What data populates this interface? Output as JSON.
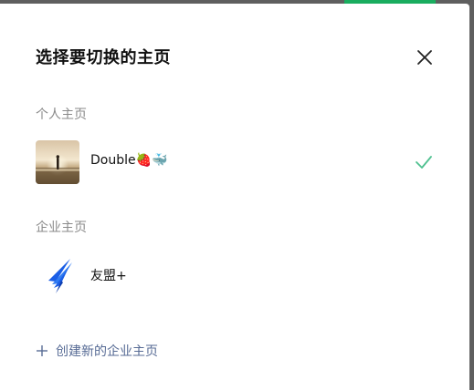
{
  "dialog": {
    "title": "选择要切换的主页",
    "close_icon": "close-icon"
  },
  "personal": {
    "section_label": "个人主页",
    "account": {
      "name": "Double🍓🐳",
      "avatar_icon": "sunset-photo-avatar",
      "selected": true,
      "check_icon": "check-icon"
    }
  },
  "enterprise": {
    "section_label": "企业主页",
    "account": {
      "name": "友盟+",
      "avatar_icon": "swift-bird-logo"
    }
  },
  "create": {
    "label": "创建新的企业主页",
    "icon": "plus-icon"
  },
  "colors": {
    "accent_check": "#4ec08f",
    "link": "#576b95",
    "logo_blue": "#1a5ee6"
  }
}
